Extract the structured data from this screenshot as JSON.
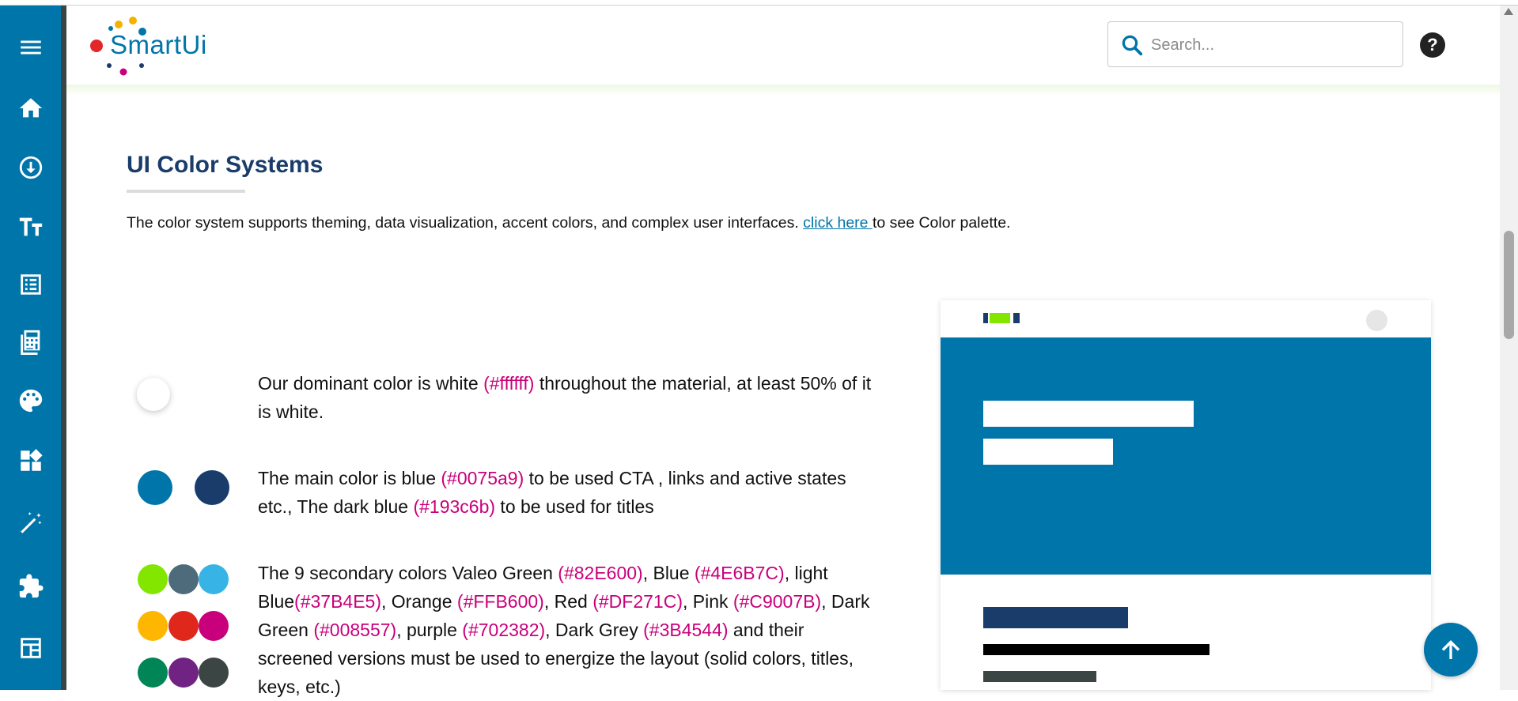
{
  "header": {
    "logo_text": "SmartUi",
    "search_placeholder": "Search...",
    "help_label": "?"
  },
  "sidebar": {
    "items": [
      {
        "icon": "menu-icon"
      },
      {
        "icon": "home-icon"
      },
      {
        "icon": "download-circle-icon"
      },
      {
        "icon": "typography-icon"
      },
      {
        "icon": "list-document-icon"
      },
      {
        "icon": "calculator-icon"
      },
      {
        "icon": "palette-icon"
      },
      {
        "icon": "widgets-icon"
      },
      {
        "icon": "magic-wand-icon"
      },
      {
        "icon": "puzzle-icon"
      },
      {
        "icon": "layout-icon"
      }
    ]
  },
  "main": {
    "title": "UI Color Systems",
    "intro": {
      "text_before": "The color system supports theming, data visualization, accent colors, and complex user interfaces. ",
      "link": "click here ",
      "text_after": "to see Color palette."
    },
    "sections": [
      {
        "parts": [
          {
            "t": "Our dominant color is white "
          },
          {
            "t": "(#ffffff)",
            "hl": true
          },
          {
            "t": " throughout the material, at least 50% of it is white."
          }
        ],
        "swatches": [
          "#ffffff"
        ]
      },
      {
        "parts": [
          {
            "t": "The main color is blue "
          },
          {
            "t": "(#0075a9)",
            "hl": true
          },
          {
            "t": " to be used CTA , links and active states etc., The dark blue "
          },
          {
            "t": "(#193c6b)",
            "hl": true
          },
          {
            "t": " to be used for titles"
          }
        ],
        "swatches": [
          "#0075a9",
          "#193c6b"
        ]
      },
      {
        "parts": [
          {
            "t": "The 9 secondary colors Valeo Green "
          },
          {
            "t": "(#82E600)",
            "hl": true
          },
          {
            "t": ", Blue "
          },
          {
            "t": "(#4E6B7C)",
            "hl": true
          },
          {
            "t": ", light Blue"
          },
          {
            "t": "(#37B4E5)",
            "hl": true
          },
          {
            "t": ", Orange "
          },
          {
            "t": "(#FFB600)",
            "hl": true
          },
          {
            "t": ", Red "
          },
          {
            "t": "(#DF271C)",
            "hl": true
          },
          {
            "t": ", Pink "
          },
          {
            "t": "(#C9007B)",
            "hl": true
          },
          {
            "t": ", Dark Green "
          },
          {
            "t": "(#008557)",
            "hl": true
          },
          {
            "t": ", purple "
          },
          {
            "t": "(#702382)",
            "hl": true
          },
          {
            "t": ", Dark Grey "
          },
          {
            "t": "(#3B4544)",
            "hl": true
          },
          {
            "t": " and their screened versions must be used to energize the layout (solid colors, titles, keys, etc.)"
          }
        ],
        "swatches": [
          "#82E600",
          "#4E6B7C",
          "#37B4E5",
          "#FFB600",
          "#DF271C",
          "#C9007B",
          "#008557",
          "#702382",
          "#3B4544"
        ]
      }
    ]
  },
  "colors": {
    "primary": "#0075a9",
    "dark_blue": "#193c6b",
    "highlight": "#c9007b",
    "valeo_green": "#82E600",
    "dark_grey": "#3B4544"
  }
}
